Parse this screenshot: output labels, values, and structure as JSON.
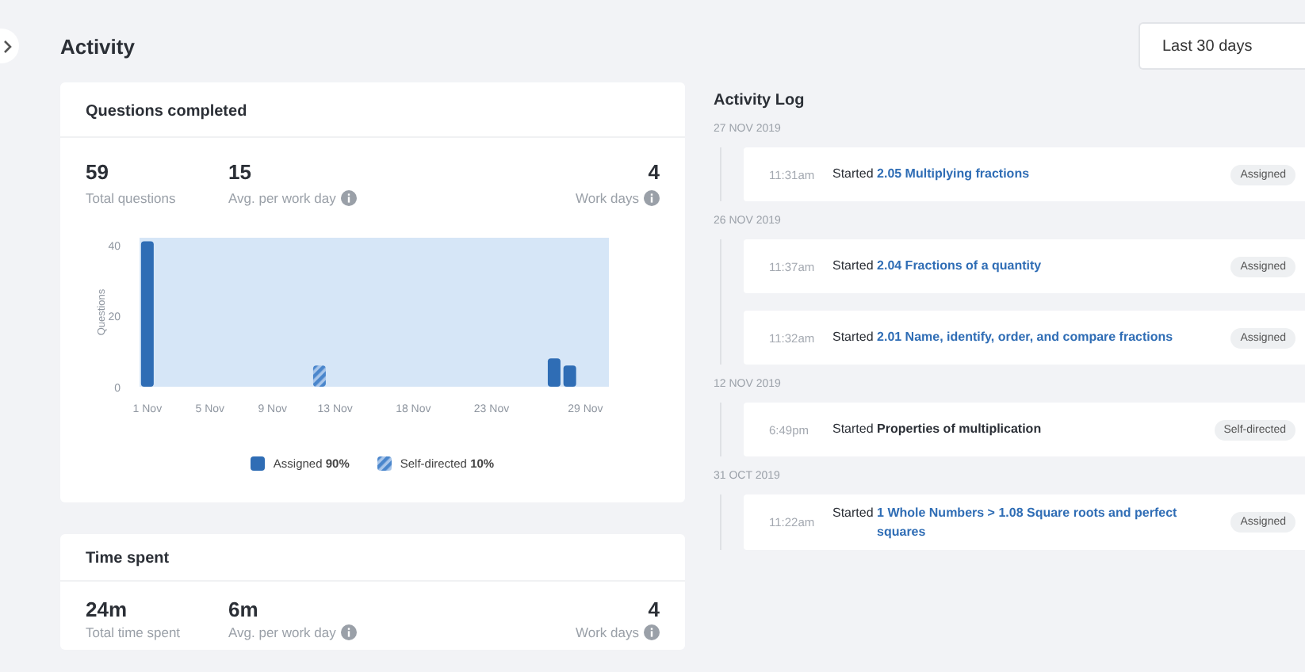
{
  "header": {
    "title": "Activity",
    "range": "Last 30 days"
  },
  "questions_card": {
    "title": "Questions completed",
    "stats": [
      {
        "value": "59",
        "label": "Total questions",
        "info": false
      },
      {
        "value": "15",
        "label": "Avg. per work day",
        "info": true
      },
      {
        "value": "4",
        "label": "Work days",
        "info": true
      }
    ],
    "chart_data": {
      "type": "bar",
      "ylabel": "Questions",
      "legend": "bottom",
      "ylim": [
        0,
        42
      ],
      "yticks": [
        0,
        20,
        40
      ],
      "categories": [
        "1 Nov",
        null,
        null,
        null,
        "5 Nov",
        null,
        null,
        null,
        "9 Nov",
        null,
        null,
        null,
        "13 Nov",
        null,
        null,
        null,
        null,
        "18 Nov",
        null,
        null,
        null,
        null,
        "23 Nov",
        null,
        null,
        null,
        null,
        null,
        "29 Nov",
        null
      ],
      "series": [
        {
          "name": "Assigned",
          "color": "#2f6db5",
          "values": [
            41,
            null,
            null,
            null,
            null,
            null,
            null,
            null,
            null,
            null,
            null,
            null,
            null,
            null,
            null,
            null,
            null,
            null,
            null,
            null,
            null,
            null,
            null,
            null,
            null,
            null,
            8,
            6,
            null,
            null
          ]
        },
        {
          "name": "Self-directed",
          "color": "#4a86cc",
          "values": [
            null,
            null,
            null,
            null,
            null,
            null,
            null,
            null,
            null,
            null,
            null,
            6,
            null,
            null,
            null,
            null,
            null,
            null,
            null,
            null,
            null,
            null,
            null,
            null,
            null,
            null,
            null,
            null,
            null,
            null
          ]
        }
      ]
    },
    "legend_shares": [
      "90%",
      "10%"
    ]
  },
  "time_card": {
    "title": "Time spent",
    "stats": [
      {
        "value": "24m",
        "label": "Total time spent",
        "info": false
      },
      {
        "value": "6m",
        "label": "Avg. per work day",
        "info": true
      },
      {
        "value": "4",
        "label": "Work days",
        "info": true
      }
    ]
  },
  "activity_log": {
    "title": "Activity Log",
    "days": [
      {
        "date": "27 NOV 2019",
        "entries": [
          {
            "time": "11:31am",
            "verb": "Started",
            "item": "2.05 Multiplying fractions",
            "linked": true,
            "tag": "Assigned"
          }
        ]
      },
      {
        "date": "26 NOV 2019",
        "entries": [
          {
            "time": "11:37am",
            "verb": "Started",
            "item": "2.04 Fractions of a quantity",
            "linked": true,
            "tag": "Assigned"
          },
          {
            "time": "11:32am",
            "verb": "Started",
            "item": "2.01 Name, identify, order, and compare fractions",
            "linked": true,
            "tag": "Assigned"
          }
        ]
      },
      {
        "date": "12 NOV 2019",
        "entries": [
          {
            "time": "6:49pm",
            "verb": "Started",
            "item": "Properties of multiplication",
            "linked": false,
            "tag": "Self-directed"
          }
        ]
      },
      {
        "date": "31 OCT 2019",
        "entries": [
          {
            "time": "11:22am",
            "verb": "Started",
            "item": "1 Whole Numbers > 1.08 Square roots and perfect squares",
            "linked": true,
            "tag": "Assigned"
          }
        ]
      }
    ]
  }
}
